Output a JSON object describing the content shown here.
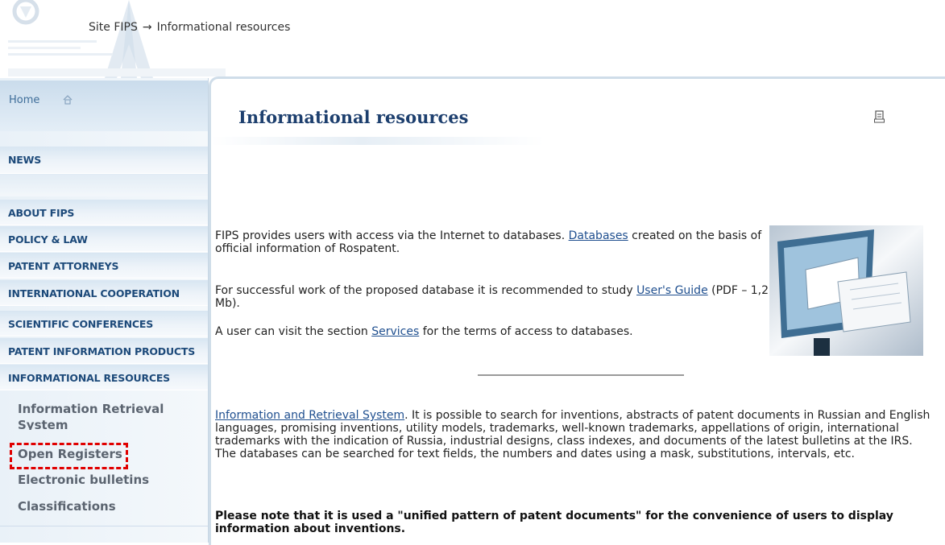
{
  "header": {
    "breadcrumb": [
      "Site FIPS",
      "Informational resources"
    ],
    "breadcrumb_sep": "→"
  },
  "sidebar": {
    "home": "Home",
    "news": "NEWS",
    "items": [
      "ABOUT FIPS",
      "POLICY & LAW",
      "PATENT ATTORNEYS",
      "INTERNATIONAL COOPERATION",
      "SCIENTIFIC CONFERENCES",
      "PATENT INFORMATION PRODUCTS",
      "INFORMATIONAL RESOURCES"
    ],
    "subitems": [
      "Information Retrieval System",
      "Open Registers",
      "Electronic bulletins",
      "Classifications"
    ]
  },
  "main": {
    "title": "Informational resources",
    "p1": {
      "before": "FIPS provides users with access via the Internet to databases. ",
      "link": "Databases",
      "after": " created on the basis of official information of Rospatent."
    },
    "p2": {
      "before": "For successful work of the proposed database it is recommended to study ",
      "link": "User's Guide",
      "after": " (PDF – 1,2 Mb)."
    },
    "p3": {
      "before": "A user can visit the section ",
      "link": "Services",
      "after": " for the terms of access to databases."
    },
    "p4": {
      "link": "Information and Retrieval System",
      "after": ". It is possible to search for inventions, abstracts of patent documents in Russian and English languages, promising inventions, utility models, trademarks, well-known trademarks, appellations of origin, international trademarks with the indication of Russia, industrial designs, class indexes, and documents of the latest bulletins at the IRS. The databases can be searched for text fields, the numbers and dates using a mask, substitutions, intervals, etc."
    },
    "p5": "Please note that it is used a \"unified pattern of patent documents\" for the convenience of users to display information about inventions."
  },
  "colors": {
    "title": "#1d3f6e",
    "link": "#1f4f8f",
    "sidebar_text": "#1d4a7a",
    "highlight_box": "#e00000"
  }
}
